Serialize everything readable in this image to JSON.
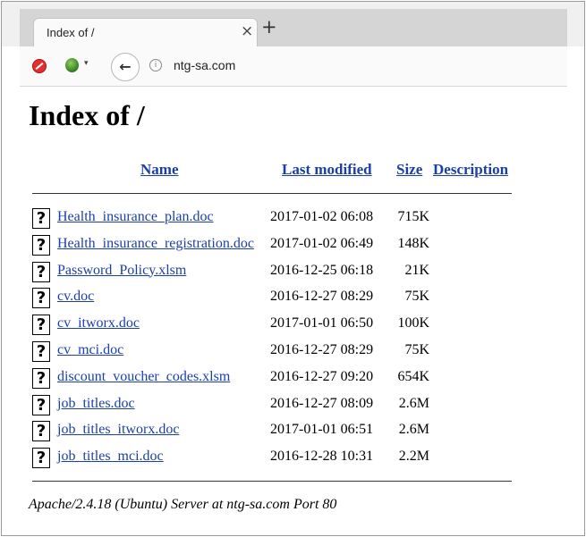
{
  "browser": {
    "tab_title": "Index of /",
    "tab_close": "×",
    "new_tab": "+",
    "back": "←",
    "info": "i",
    "url": "ntg-sa.com",
    "ext_dropdown": "▾"
  },
  "page": {
    "heading": "Index of /",
    "columns": {
      "name": "Name",
      "last_modified": "Last modified",
      "size": "Size",
      "description": "Description"
    },
    "icon_glyph": "?",
    "files": [
      {
        "name": "Health_insurance_plan.doc",
        "modified": "2017-01-02 06:08",
        "size": "715K"
      },
      {
        "name": "Health_insurance_registration.doc",
        "modified": "2017-01-02 06:49",
        "size": "148K"
      },
      {
        "name": "Password_Policy.xlsm",
        "modified": "2016-12-25 06:18",
        "size": "21K"
      },
      {
        "name": "cv.doc",
        "modified": "2016-12-27 08:29",
        "size": "75K"
      },
      {
        "name": "cv_itworx.doc",
        "modified": "2017-01-01 06:50",
        "size": "100K"
      },
      {
        "name": "cv_mci.doc",
        "modified": "2016-12-27 08:29",
        "size": "75K"
      },
      {
        "name": "discount_voucher_codes.xlsm",
        "modified": "2016-12-27 09:20",
        "size": "654K"
      },
      {
        "name": "job_titles.doc",
        "modified": "2016-12-27 08:09",
        "size": "2.6M"
      },
      {
        "name": "job_titles_itworx.doc",
        "modified": "2017-01-01 06:51",
        "size": "2.6M"
      },
      {
        "name": "job_titles_mci.doc",
        "modified": "2016-12-28 10:31",
        "size": "2.2M"
      }
    ],
    "footer": "Apache/2.4.18 (Ubuntu) Server at ntg-sa.com Port 80"
  }
}
